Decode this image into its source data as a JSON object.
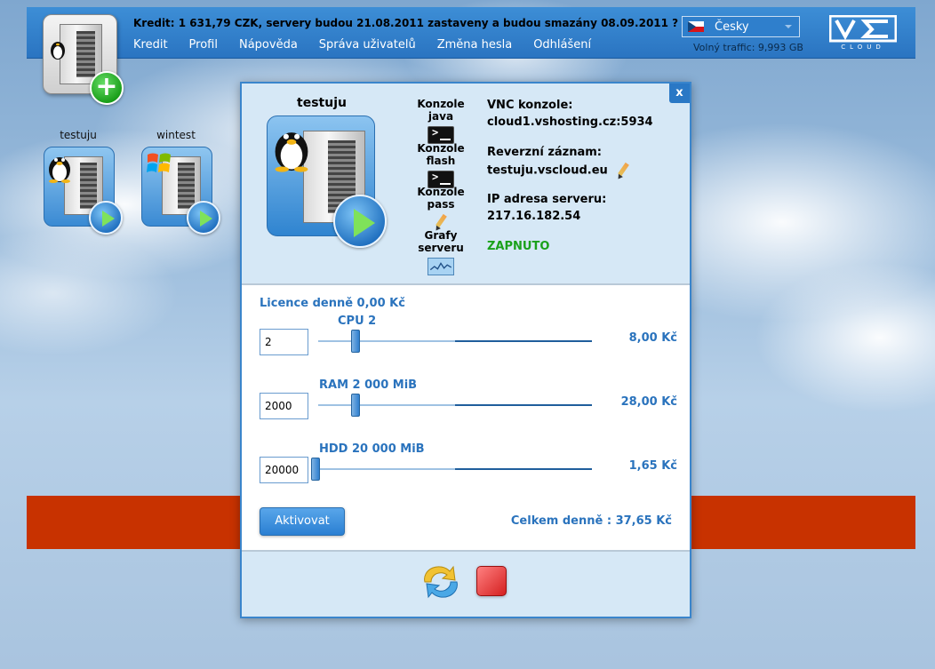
{
  "header": {
    "credit_text": "Kredit: 1 631,79 CZK, servery budou 21.08.2011 zastaveny a budou smazány 08.09.2011 ?",
    "nav": [
      {
        "label": "Kredit"
      },
      {
        "label": "Profil"
      },
      {
        "label": "Nápověda"
      },
      {
        "label": "Správa uživatelů"
      },
      {
        "label": "Změna hesla"
      },
      {
        "label": "Odhlášení"
      }
    ],
    "language": "Česky",
    "traffic": "Volný traffic: 9,993 GB",
    "logo_text": "CLOUD"
  },
  "desktop": {
    "servers": [
      {
        "name": "testuju",
        "os_icon": "tux-icon"
      },
      {
        "name": "wintest",
        "os_icon": "windows-icon"
      }
    ]
  },
  "dialog": {
    "close_label": "x",
    "vm_name": "testuju",
    "consoles": [
      {
        "label": "Konzole java",
        "icon": "terminal-icon"
      },
      {
        "label": "Konzole flash",
        "icon": "terminal-icon"
      },
      {
        "label": "Konzole pass",
        "icon": "pencil-icon"
      },
      {
        "label": "Grafy serveru",
        "icon": "graph-icon"
      }
    ],
    "vnc_label": "VNC konzole:",
    "vnc_value": "cloud1.vshosting.cz:5934",
    "reverse_label": "Reverzní záznam:",
    "reverse_value": "testuju.vscloud.eu",
    "ip_label": "IP adresa serveru:",
    "ip_value": "217.16.182.54",
    "status": "ZAPNUTO",
    "status_color": "#1aa11a",
    "licence": "Licence denně 0,00 Kč",
    "sliders": [
      {
        "title": "CPU 2",
        "input_value": "2",
        "price": "8,00 Kč"
      },
      {
        "title": "RAM 2 000 MiB",
        "input_value": "2000",
        "price": "28,00 Kč"
      },
      {
        "title": "HDD 20 000 MiB",
        "input_value": "20000",
        "price": "1,65 Kč"
      }
    ],
    "activate_label": "Aktivovat",
    "total": "Celkem denně : 37,65 Kč"
  },
  "colors": {
    "accent": "#2a78c5",
    "banner_red": "#c83200"
  }
}
